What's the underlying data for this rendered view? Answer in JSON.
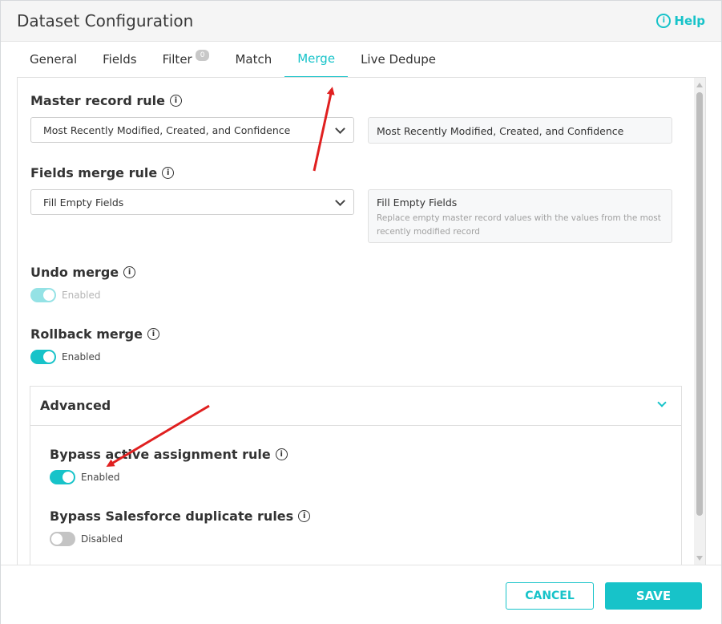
{
  "dialog": {
    "title": "Dataset Configuration",
    "help_label": "Help"
  },
  "tabs": [
    {
      "label": "General"
    },
    {
      "label": "Fields"
    },
    {
      "label": "Filter",
      "badge": "0"
    },
    {
      "label": "Match"
    },
    {
      "label": "Merge",
      "active": true
    },
    {
      "label": "Live Dedupe"
    }
  ],
  "master_record_rule": {
    "label": "Master record rule",
    "selected": "Most Recently Modified, Created, and Confidence",
    "description_title": "Most Recently Modified, Created, and Confidence"
  },
  "fields_merge_rule": {
    "label": "Fields merge rule",
    "selected": "Fill Empty Fields",
    "description_title": "Fill Empty Fields",
    "description_text": "Replace empty master record values with the values from the most recently modified record"
  },
  "undo_merge": {
    "label": "Undo merge",
    "state": "Enabled"
  },
  "rollback_merge": {
    "label": "Rollback merge",
    "state": "Enabled"
  },
  "advanced": {
    "title": "Advanced",
    "bypass_assignment": {
      "label": "Bypass active assignment rule",
      "state": "Enabled"
    },
    "bypass_duplicate": {
      "label": "Bypass Salesforce duplicate rules",
      "state": "Disabled"
    }
  },
  "footer": {
    "cancel_label": "CANCEL",
    "save_label": "SAVE"
  },
  "colors": {
    "accent": "#17c3c9",
    "annotation_arrow": "#e02020"
  }
}
